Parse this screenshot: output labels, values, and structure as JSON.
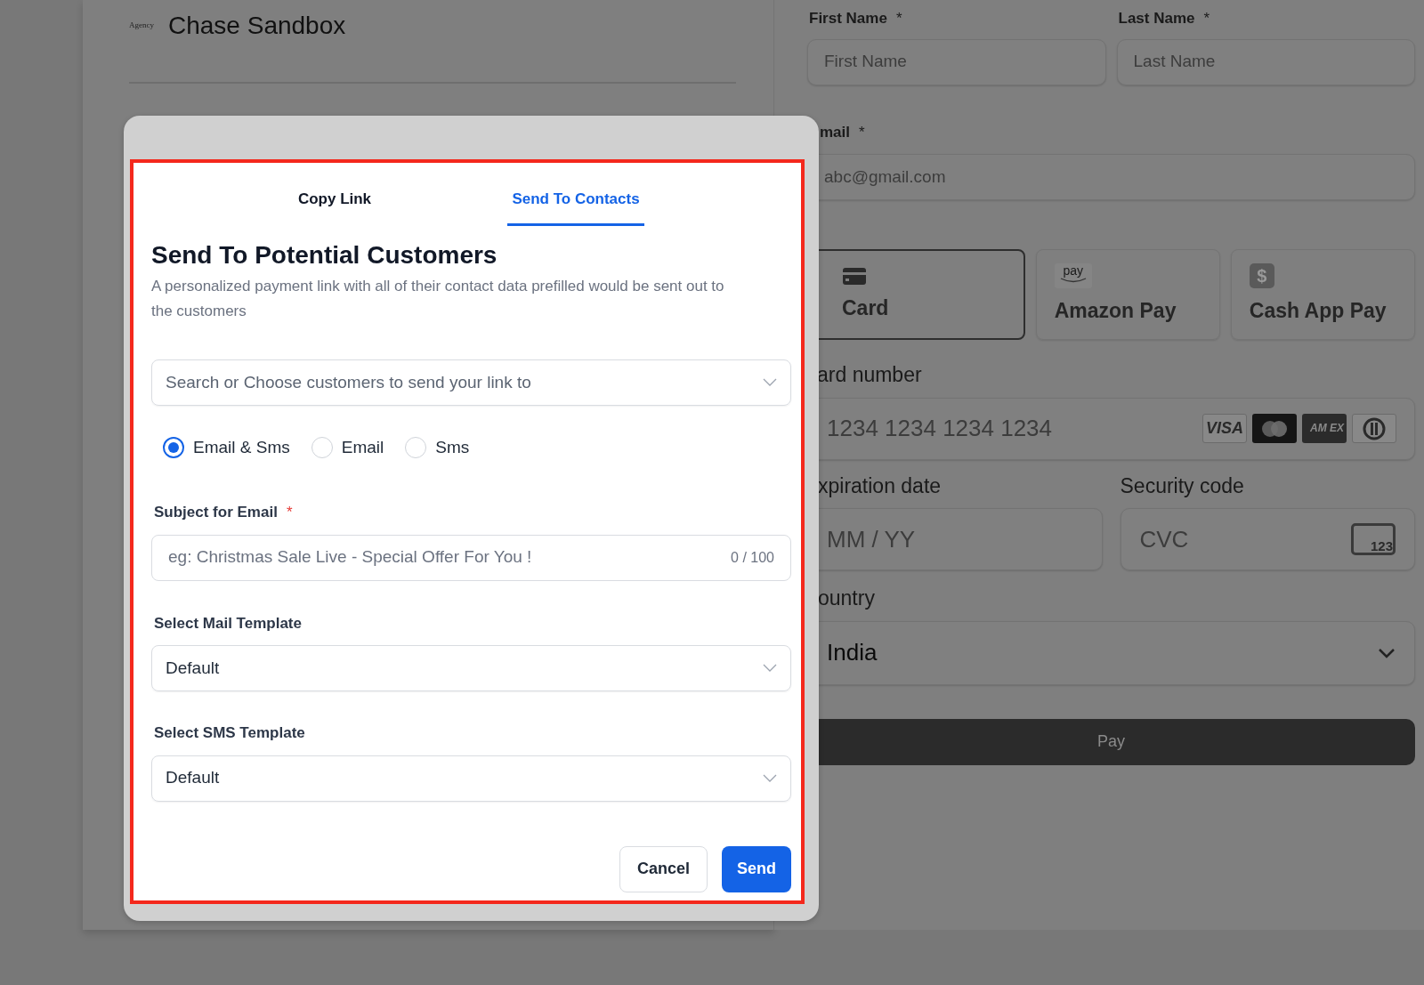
{
  "background_page": {
    "logo_text": "Agency",
    "title": "Chase Sandbox"
  },
  "checkout_form": {
    "name_fields": [
      {
        "label": "First Name",
        "required_mark": "*",
        "placeholder": "First Name"
      },
      {
        "label": "Last Name",
        "required_mark": "*",
        "placeholder": "Last Name"
      }
    ],
    "email": {
      "label": "mail",
      "required_mark": "*",
      "placeholder": "abc@gmail.com"
    },
    "payment_methods": [
      {
        "kind": "card",
        "label": "Card",
        "selected": true
      },
      {
        "kind": "amazon",
        "label": "Amazon Pay",
        "badge": "pay",
        "selected": false
      },
      {
        "kind": "cashapp",
        "label": "Cash App Pay",
        "badge": "$",
        "selected": false
      }
    ],
    "card_number": {
      "label": "ard number",
      "placeholder": "1234 1234 1234 1234"
    },
    "card_brands": [
      {
        "kind": "visa",
        "text": "VISA"
      },
      {
        "kind": "mastercard"
      },
      {
        "kind": "amex",
        "text": "AM EX"
      },
      {
        "kind": "diners"
      }
    ],
    "expiration": {
      "label": "xpiration date",
      "placeholder": "MM / YY"
    },
    "security_code": {
      "label": "Security code",
      "placeholder": "CVC",
      "icon_text": "123"
    },
    "country": {
      "label": "ountry",
      "value": "India"
    },
    "pay_button": "Pay"
  },
  "modal": {
    "tabs": [
      {
        "label": "Copy Link",
        "selected": false
      },
      {
        "label": "Send To Contacts",
        "selected": true
      }
    ],
    "heading": "Send To Potential Customers",
    "description": "A personalized payment link with all of their contact data prefilled would be sent out to the customers",
    "customer_select": {
      "placeholder": "Search or Choose customers to send your link to"
    },
    "channels": [
      {
        "label": "Email & Sms",
        "selected": true
      },
      {
        "label": "Email",
        "selected": false
      },
      {
        "label": "Sms",
        "selected": false
      }
    ],
    "subject": {
      "label": "Subject for Email",
      "required_mark": "*",
      "placeholder": "eg: Christmas Sale Live - Special Offer For You !",
      "counter": "0 / 100"
    },
    "templates": [
      {
        "label": "Select Mail Template",
        "value": "Default"
      },
      {
        "label": "Select SMS Template",
        "value": "Default"
      }
    ],
    "buttons": [
      {
        "kind": "secondary",
        "label": "Cancel"
      },
      {
        "kind": "primary",
        "label": "Send"
      }
    ]
  }
}
